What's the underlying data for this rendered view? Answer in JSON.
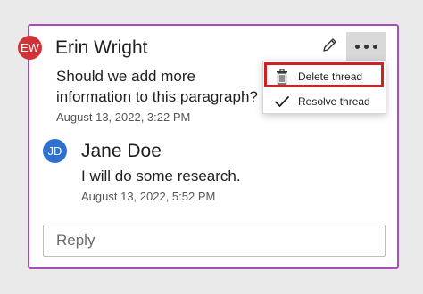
{
  "thread": {
    "author": {
      "initials": "EW",
      "name": "Erin Wright",
      "message": "Should we add more information to this paragraph?",
      "timestamp": "August 13, 2022, 3:22 PM",
      "avatar_color": "#d13438"
    },
    "reply": {
      "initials": "JD",
      "name": "Jane Doe",
      "message": "I will do some research.",
      "timestamp": "August 13, 2022, 5:52 PM",
      "avatar_color": "#2f6fcf"
    },
    "reply_placeholder": "Reply"
  },
  "toolbar": {
    "edit_icon": "pencil-icon",
    "more_icon": "more-options-icon"
  },
  "menu": {
    "items": [
      {
        "label": "Delete thread",
        "icon": "trash-icon",
        "highlighted": true
      },
      {
        "label": "Resolve thread",
        "icon": "checkmark-icon"
      }
    ]
  },
  "colors": {
    "card_border": "#a24fb6",
    "highlight_border": "#d21f26"
  }
}
